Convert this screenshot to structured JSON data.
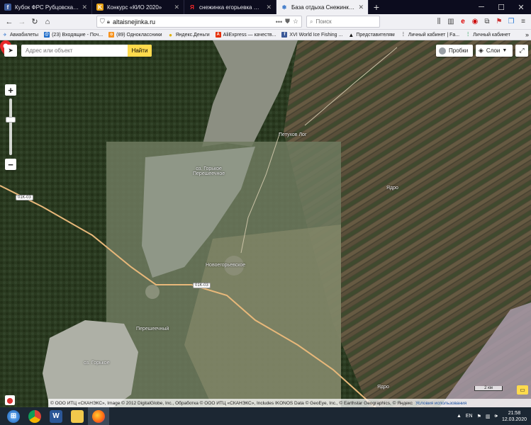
{
  "tabs": [
    {
      "label": "Кубок ФРС Рубцовска по блесне",
      "favicon_color": "#3b5998"
    },
    {
      "label": "Конкурс «КИО 2020»",
      "favicon_color": "#e8a317"
    },
    {
      "label": "снежинка егорьевка — Яндекс",
      "favicon_color": "#ff0000"
    },
    {
      "label": "База отдыха Снежинка - Главная",
      "favicon_color": "#2a6cc4"
    }
  ],
  "nav": {
    "url": "altaisnejinka.ru",
    "search_placeholder": "Поиск"
  },
  "bookmarks": [
    {
      "label": "Авиабилеты",
      "color": "#5b8fd6"
    },
    {
      "label": "(23) Входящие - Поч...",
      "color": "#1b6ac9"
    },
    {
      "label": "(89) Одноклассники",
      "color": "#f7931e"
    },
    {
      "label": "Яндекс.Деньги",
      "color": "#e0b000"
    },
    {
      "label": "AliExpress — качеств...",
      "color": "#e62e04"
    },
    {
      "label": "XVI World Ice Fishing ...",
      "color": "#3b5998"
    },
    {
      "label": "Представителям",
      "color": "#111111"
    },
    {
      "label": "Личный кабинет | Fa...",
      "color": "#444444"
    },
    {
      "label": "Личный кабинет",
      "color": "#1f9d55"
    }
  ],
  "map": {
    "search_placeholder": "Адрес или объект",
    "find_label": "Найти",
    "traffic_label": "Пробки",
    "layers_label": "Слои",
    "scale_label": "2 км",
    "labels": {
      "petukhov_log": "Петухов Лог",
      "lake_gorkoe_pereshechnoe": "оз. Горькое\nПерешеечное",
      "novoegoryevskoe": "Новоегорьевское",
      "pereshechny": "Перешеечный",
      "lake_gorkoe": "оз. Горькое",
      "yadro1": "Ядро",
      "yadro2": "Ядро",
      "road1": "01К-03",
      "road2": "01К-03"
    },
    "copyright": "© ООО ИТЦ «СКАНЭКС», Image © 2012 DigitalGlobe, Inc., Обработка © ООО ИТЦ «СКАНЭКС», Includes IKONOS Data © GeoEye, Inc., © Earthstar Geographics, © Яндекс",
    "terms_label": "Условия использования"
  },
  "taskbar": {
    "lang": "EN",
    "time": "21:58",
    "date": "12.03.2020"
  }
}
